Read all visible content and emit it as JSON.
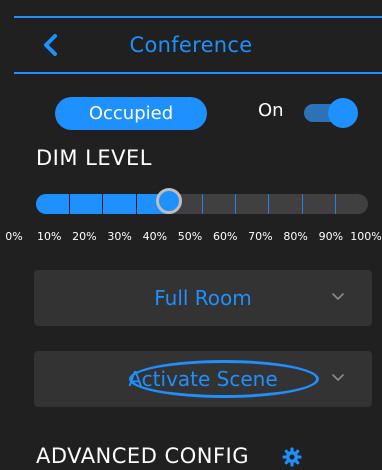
{
  "header": {
    "title": "Conference",
    "back_icon": "chevron-left-icon"
  },
  "occupancy": {
    "status_label": "Occupied",
    "power_label": "On",
    "power_on": true
  },
  "dim": {
    "label": "DIM LEVEL",
    "level_percent": 40,
    "scale": [
      "0%",
      "10%",
      "20%",
      "30%",
      "40%",
      "50%",
      "60%",
      "70%",
      "80%",
      "90%",
      "100%"
    ]
  },
  "dropdowns": {
    "room": "Full Room",
    "scene": "Activate Scene"
  },
  "advanced": {
    "label": "ADVANCED CONFIG",
    "icon": "gear-icon"
  },
  "colors": {
    "accent": "#1e90ff",
    "background": "#202020",
    "panel": "#333333"
  }
}
